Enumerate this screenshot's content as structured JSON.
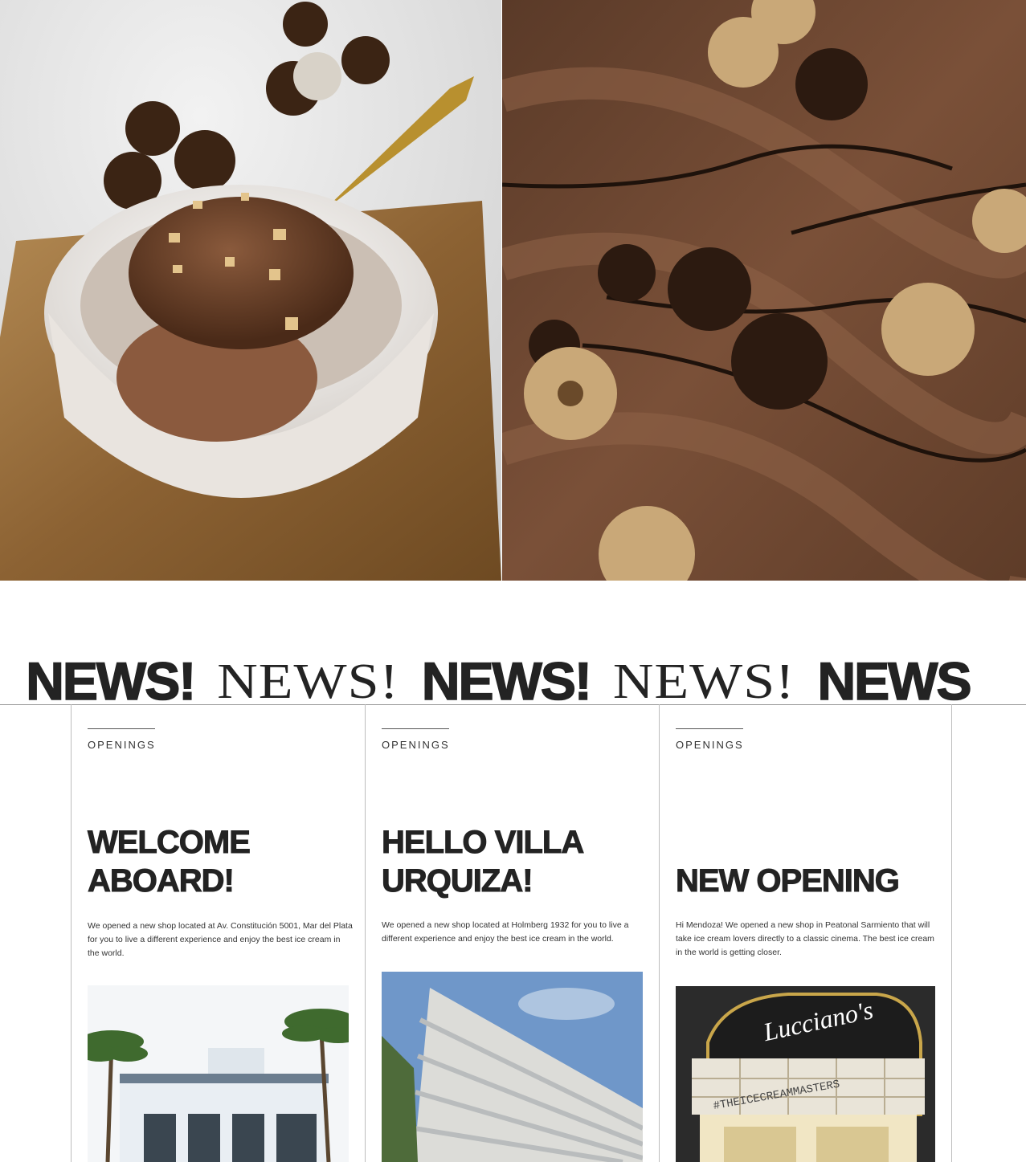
{
  "news_ticker": {
    "words": [
      "S!",
      "NEWS!",
      "NEWS!",
      "NEWS!",
      "NEWS!",
      "NEWS"
    ]
  },
  "hero": {
    "left_image": "chocolate-ice-cream-bowl",
    "right_image": "chocolate-hazelnut-gelato-closeup"
  },
  "cards": [
    {
      "category": "OPENINGS",
      "title": "WELCOME ABOARD!",
      "text": "We opened a new shop located at Av. Constitución 5001, Mar del Plata for you to live a different experience and enjoy the best ice cream in the world.",
      "image": "storefront-with-palm-trees"
    },
    {
      "category": "OPENINGS",
      "title": "HELLO VILLA URQUIZA!",
      "text": "We opened a new shop located at Holmberg 1932 for you to live a different experience and enjoy the best ice cream in the world.",
      "image": "modern-apartment-building"
    },
    {
      "category": "OPENINGS",
      "title": "NEW OPENING",
      "text": "Hi Mendoza! We opened a new shop in Peatonal Sarmiento that will take ice cream lovers directly to a classic cinema. The best ice cream in the world is getting closer.",
      "image": "cinema-style-storefront",
      "image_sign": "Lucciano's",
      "image_marquee": "#THEICECREAMMASTERS"
    }
  ],
  "colors": {
    "text_dark": "#232323",
    "divider": "#bdbdbd"
  }
}
